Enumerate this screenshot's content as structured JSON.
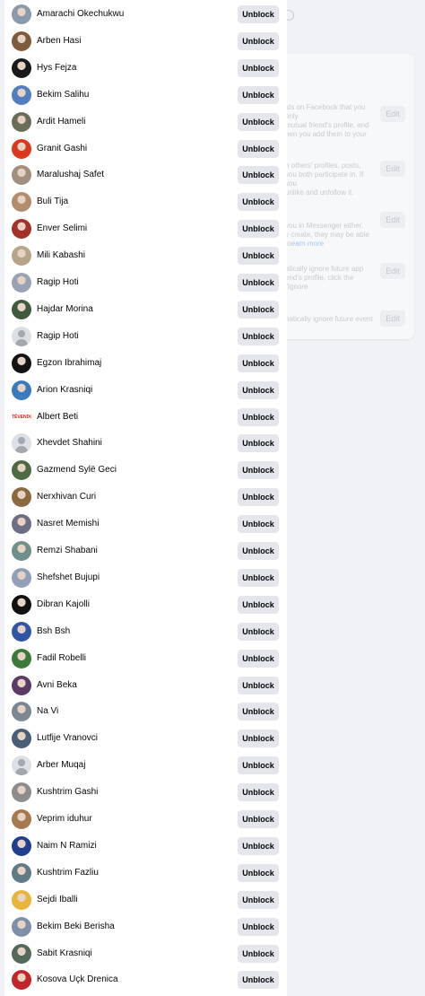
{
  "unblock_label": "Unblock",
  "blocked_users": [
    {
      "name": "Amarachi Okechukwu",
      "avatar": "photo",
      "color": "#8a99ab"
    },
    {
      "name": "Arben Hasi",
      "avatar": "photo",
      "color": "#7d5b3c"
    },
    {
      "name": "Hys Fejza",
      "avatar": "photo",
      "color": "#1a1a1a"
    },
    {
      "name": "Bekim Salihu",
      "avatar": "photo",
      "color": "#4f7fc1"
    },
    {
      "name": "Ardit Hameli",
      "avatar": "photo",
      "color": "#6a6e58"
    },
    {
      "name": "Granit Gashi",
      "avatar": "photo",
      "color": "#d9391e"
    },
    {
      "name": "Maralushaj Safet",
      "avatar": "photo",
      "color": "#a38f7d"
    },
    {
      "name": "Buli Tija",
      "avatar": "photo",
      "color": "#b38b6d"
    },
    {
      "name": "Enver Selimi",
      "avatar": "photo",
      "color": "#a3322a"
    },
    {
      "name": "Mili Kabashi",
      "avatar": "photo",
      "color": "#b7a58a"
    },
    {
      "name": "Ragip Hoti",
      "avatar": "photo",
      "color": "#9aa3b5"
    },
    {
      "name": "Hajdar Morina",
      "avatar": "photo",
      "color": "#3e5a3f"
    },
    {
      "name": "Ragip Hoti",
      "avatar": "default",
      "color": "#dcdfe3"
    },
    {
      "name": "Egzon Ibrahimaj",
      "avatar": "photo",
      "color": "#141414"
    },
    {
      "name": "Arion Krasniqi",
      "avatar": "photo",
      "color": "#3a7bbf"
    },
    {
      "name": "Albert Beti",
      "avatar": "brand",
      "color": "#ffffff",
      "brand_text": "TËVENDOS"
    },
    {
      "name": "Xhevdet Shahini",
      "avatar": "default",
      "color": "#dcdfe3"
    },
    {
      "name": "Gazmend Sylë Geci",
      "avatar": "photo",
      "color": "#4d6b43"
    },
    {
      "name": "Nerxhivan Curi",
      "avatar": "photo",
      "color": "#8c6a3f"
    },
    {
      "name": "Nasret Memishi",
      "avatar": "photo",
      "color": "#6d6f86"
    },
    {
      "name": "Remzi Shabani",
      "avatar": "photo",
      "color": "#6f8f8a"
    },
    {
      "name": "Shefshet Bujupi",
      "avatar": "photo",
      "color": "#8fa0b8"
    },
    {
      "name": "Dibran Kajolli",
      "avatar": "photo",
      "color": "#111111"
    },
    {
      "name": "Bsh Bsh",
      "avatar": "photo",
      "color": "#2f56a6"
    },
    {
      "name": "Fadil Robelli",
      "avatar": "photo",
      "color": "#3c7a3a"
    },
    {
      "name": "Avni Beka",
      "avatar": "photo",
      "color": "#5c3a66"
    },
    {
      "name": "Na Vi",
      "avatar": "photo",
      "color": "#7c8794"
    },
    {
      "name": "Lutfije Vranovci",
      "avatar": "photo",
      "color": "#4b5e78"
    },
    {
      "name": "Arber Muqaj",
      "avatar": "default",
      "color": "#dcdfe3"
    },
    {
      "name": "Kushtrim Gashi",
      "avatar": "photo",
      "color": "#8d8d8d"
    },
    {
      "name": "Veprim iduhur",
      "avatar": "photo",
      "color": "#a7794e"
    },
    {
      "name": "Naim N Ramizi",
      "avatar": "photo",
      "color": "#1f3f8f"
    },
    {
      "name": "Kushtrim Fazliu",
      "avatar": "photo",
      "color": "#5f7b86"
    },
    {
      "name": "Sejdi Iballi",
      "avatar": "photo",
      "color": "#e8b43a"
    },
    {
      "name": "Bekim Beki Berisha",
      "avatar": "photo",
      "color": "#7f8fa8"
    },
    {
      "name": "Sabit Krasniqi",
      "avatar": "photo",
      "color": "#556b5a"
    },
    {
      "name": "Kosova Uçk Drenica",
      "avatar": "photo",
      "color": "#c0262a"
    }
  ],
  "background_page": {
    "sections": [
      {
        "text": "sts on Facebook that you only\nmutual friend's profile, and\nhen you add them to your",
        "edit_label": "Edit"
      },
      {
        "text": "n others' profiles, posts,\nyou both participate in. If you\nunlike and unfollow it.",
        "edit_label": "Edit"
      },
      {
        "text": "you in Messenger either.\ny create, they may be able to",
        "link": "earn more",
        "edit_label": "Edit"
      },
      {
        "text": "atically ignore future app\nend's profile, click the \"Ignore",
        "edit_label": "Edit"
      },
      {
        "text": "natically ignore future event",
        "edit_label": "Edit"
      }
    ]
  }
}
